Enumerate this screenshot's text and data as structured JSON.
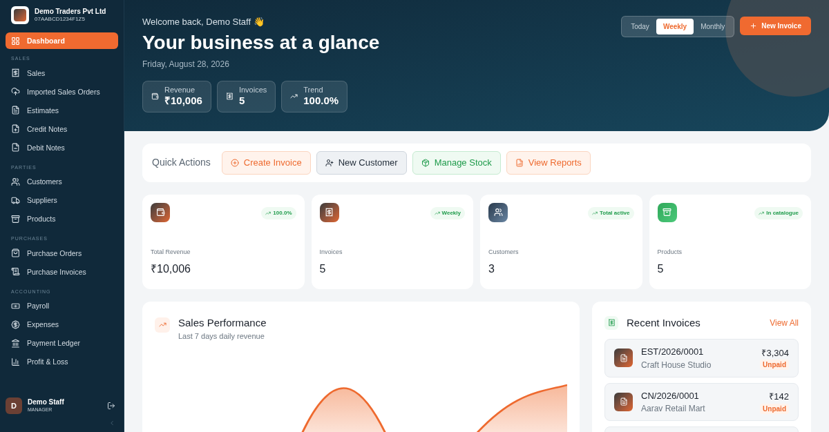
{
  "company": {
    "name": "Demo Traders Pvt Ltd",
    "gstin": "07AABCD1234F1Z5"
  },
  "sidebar": {
    "top": {
      "label": "Dashboard",
      "selected": true
    },
    "sections": [
      {
        "title": "SALES",
        "items": [
          {
            "label": "Sales",
            "selected": false
          },
          {
            "label": "Imported Sales Orders",
            "selected": false
          },
          {
            "label": "Estimates",
            "selected": false
          },
          {
            "label": "Credit Notes",
            "selected": false
          },
          {
            "label": "Debit Notes",
            "selected": false
          }
        ]
      },
      {
        "title": "PARTIES",
        "items": [
          {
            "label": "Customers",
            "selected": false
          },
          {
            "label": "Suppliers",
            "selected": false
          },
          {
            "label": "Products",
            "selected": false
          }
        ]
      },
      {
        "title": "PURCHASES",
        "items": [
          {
            "label": "Purchase Orders",
            "selected": false
          },
          {
            "label": "Purchase Invoices",
            "selected": false
          }
        ]
      },
      {
        "title": "ACCOUNTING",
        "items": [
          {
            "label": "Payroll",
            "selected": false
          },
          {
            "label": "Expenses",
            "selected": false
          },
          {
            "label": "Payment Ledger",
            "selected": false
          },
          {
            "label": "Profit & Loss",
            "selected": false
          }
        ]
      }
    ]
  },
  "user": {
    "initial": "D",
    "name": "Demo Staff",
    "role": "MANAGER"
  },
  "hero": {
    "welcome": "Welcome back, Demo Staff 👋",
    "title": "Your business at a glance",
    "date": "Friday, August 28, 2026",
    "stats": [
      {
        "label": "Revenue",
        "value": "₹10,006"
      },
      {
        "label": "Invoices",
        "value": "5"
      },
      {
        "label": "Trend",
        "value": "100.0%"
      }
    ],
    "periods": [
      {
        "label": "Today",
        "selected": false
      },
      {
        "label": "Weekly",
        "selected": true
      },
      {
        "label": "Monthly",
        "selected": false
      }
    ],
    "new_invoice": "New Invoice"
  },
  "quick_actions": {
    "title": "Quick Actions",
    "buttons": [
      {
        "label": "Create Invoice",
        "kind": "orange"
      },
      {
        "label": "New Customer",
        "kind": "gray"
      },
      {
        "label": "Manage Stock",
        "kind": "green"
      },
      {
        "label": "View Reports",
        "kind": "orange"
      }
    ]
  },
  "stat_cards": [
    {
      "badge": "100.0%",
      "label": "Total Revenue",
      "value": "₹10,006"
    },
    {
      "badge": "Weekly",
      "label": "Invoices",
      "value": "5"
    },
    {
      "badge": "Total active",
      "label": "Customers",
      "value": "3"
    },
    {
      "badge": "In catalogue",
      "label": "Products",
      "value": "5"
    }
  ],
  "sales_performance": {
    "title": "Sales Performance",
    "subtitle": "Last 7 days daily revenue"
  },
  "recent_invoices": {
    "title": "Recent Invoices",
    "view_all": "View All",
    "items": [
      {
        "number": "EST/2026/0001",
        "customer": "Craft House Studio",
        "amount": "₹3,304",
        "status": "Unpaid"
      },
      {
        "number": "CN/2026/0001",
        "customer": "Aarav Retail Mart",
        "amount": "₹142",
        "status": "Unpaid"
      }
    ]
  }
}
